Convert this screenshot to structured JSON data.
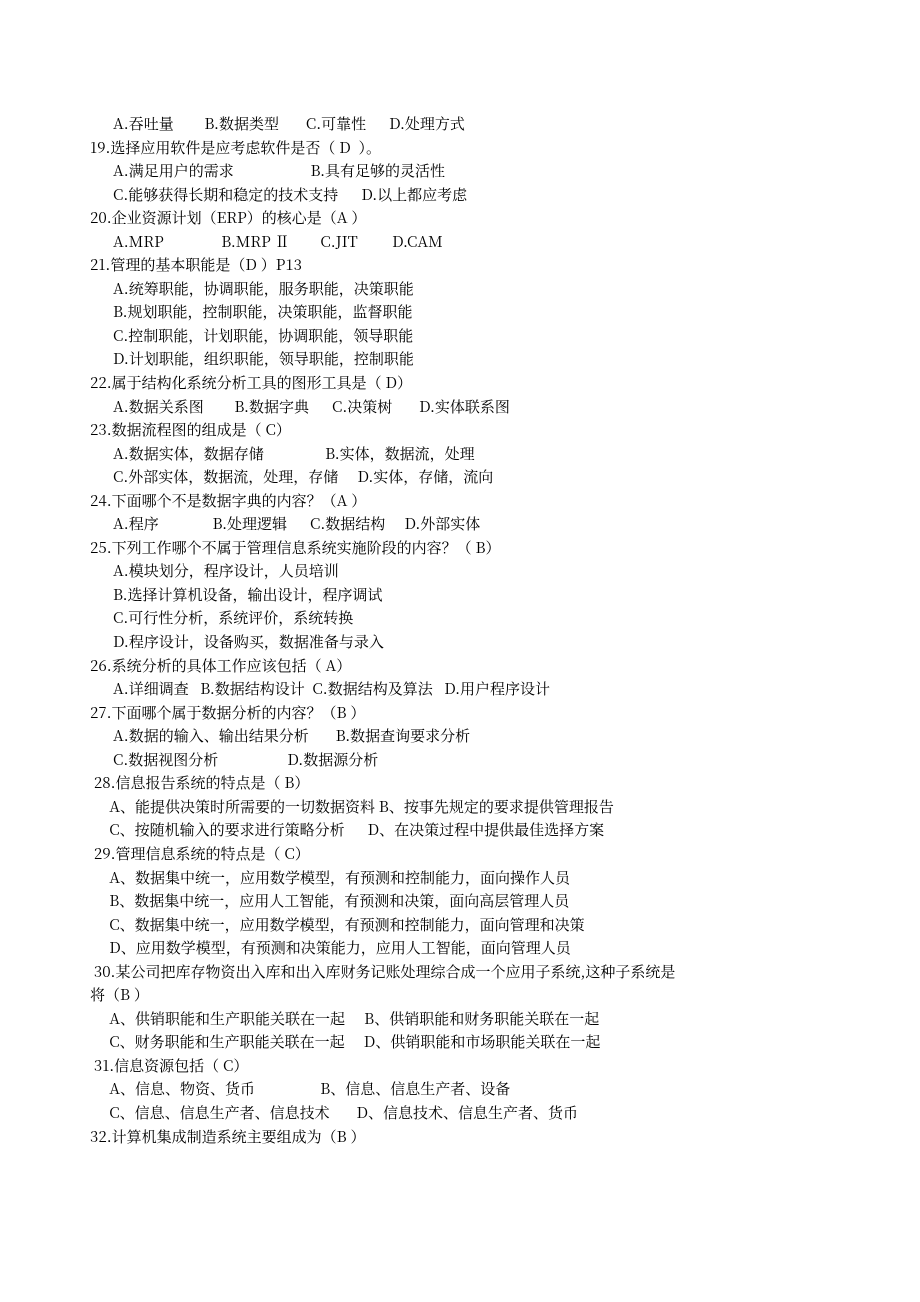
{
  "lines": [
    "      A.吞吐量        B.数据类型       C.可靠性      D.处理方式",
    "19.选择应用软件是应考虑软件是否（ D  ）。",
    "      A.满足用户的需求                    B.具有足够的灵活性",
    "      C.能够获得长期和稳定的技术支持      D.以上都应考虑",
    "20.企业资源计划（ERP）的核心是（A ）",
    "      A.MRP               B.MRP Ⅱ        C.JIT         D.CAM",
    "21.管理的基本职能是（D ）P13",
    "      A.统筹职能，协调职能，服务职能，决策职能",
    "      B.规划职能，控制职能，决策职能，监督职能",
    "      C.控制职能，计划职能，协调职能，领导职能",
    "      D.计划职能，组织职能，领导职能，控制职能",
    "22.属于结构化系统分析工具的图形工具是（ D）",
    "      A.数据关系图        B.数据字典      C.决策树       D.实体联系图",
    "23.数据流程图的组成是（ C）",
    "      A.数据实体，数据存储                B.实体，数据流，处理",
    "      C.外部实体，数据流，处理，存储     D.实体，存储，流向",
    "24.下面哪个不是数据字典的内容？（A ）",
    "      A.程序              B.处理逻辑      C.数据结构     D.外部实体",
    "25.下列工作哪个不属于管理信息系统实施阶段的内容？（ B）",
    "      A.模块划分，程序设计，人员培训",
    "      B.选择计算机设备，输出设计，程序调试",
    "      C.可行性分析，系统评价，系统转换",
    "      D.程序设计，设备购买，数据准备与录入",
    "26.系统分析的具体工作应该包括（ A）",
    "      A.详细调查   B.数据结构设计  C.数据结构及算法   D.用户程序设计",
    "27.下面哪个属于数据分析的内容？（B ）",
    "      A.数据的输入、输出结果分析       B.数据查询要求分析",
    "      C.数据视图分析                  D.数据源分析",
    " 28.信息报告系统的特点是（ B）",
    "     A、能提供决策时所需要的一切数据资料 B、按事先规定的要求提供管理报告",
    "     C、按随机输入的要求进行策略分析      D、在决策过程中提供最佳选择方案",
    " 29.管理信息系统的特点是（ C）",
    "     A、数据集中统一，应用数学模型，有预测和控制能力，面向操作人员",
    "     B、数据集中统一，应用人工智能，有预测和决策，面向高层管理人员",
    "     C、数据集中统一，应用数学模型，有预测和控制能力，面向管理和决策",
    "     D、应用数学模型，有预测和决策能力，应用人工智能，面向管理人员",
    " 30.某公司把库存物资出入库和出入库财务记账处理综合成一个应用子系统,这种子系统是",
    "将（B ）",
    "     A、供销职能和生产职能关联在一起     B、供销职能和财务职能关联在一起",
    "     C、财务职能和生产职能关联在一起     D、供销职能和市场职能关联在一起",
    " 31.信息资源包括（ C）",
    "     A、信息、物资、货币                 B、信息、信息生产者、设备",
    "     C、信息、信息生产者、信息技术       D、信息技术、信息生产者、货币",
    "32.计算机集成制造系统主要组成为（B ）"
  ]
}
